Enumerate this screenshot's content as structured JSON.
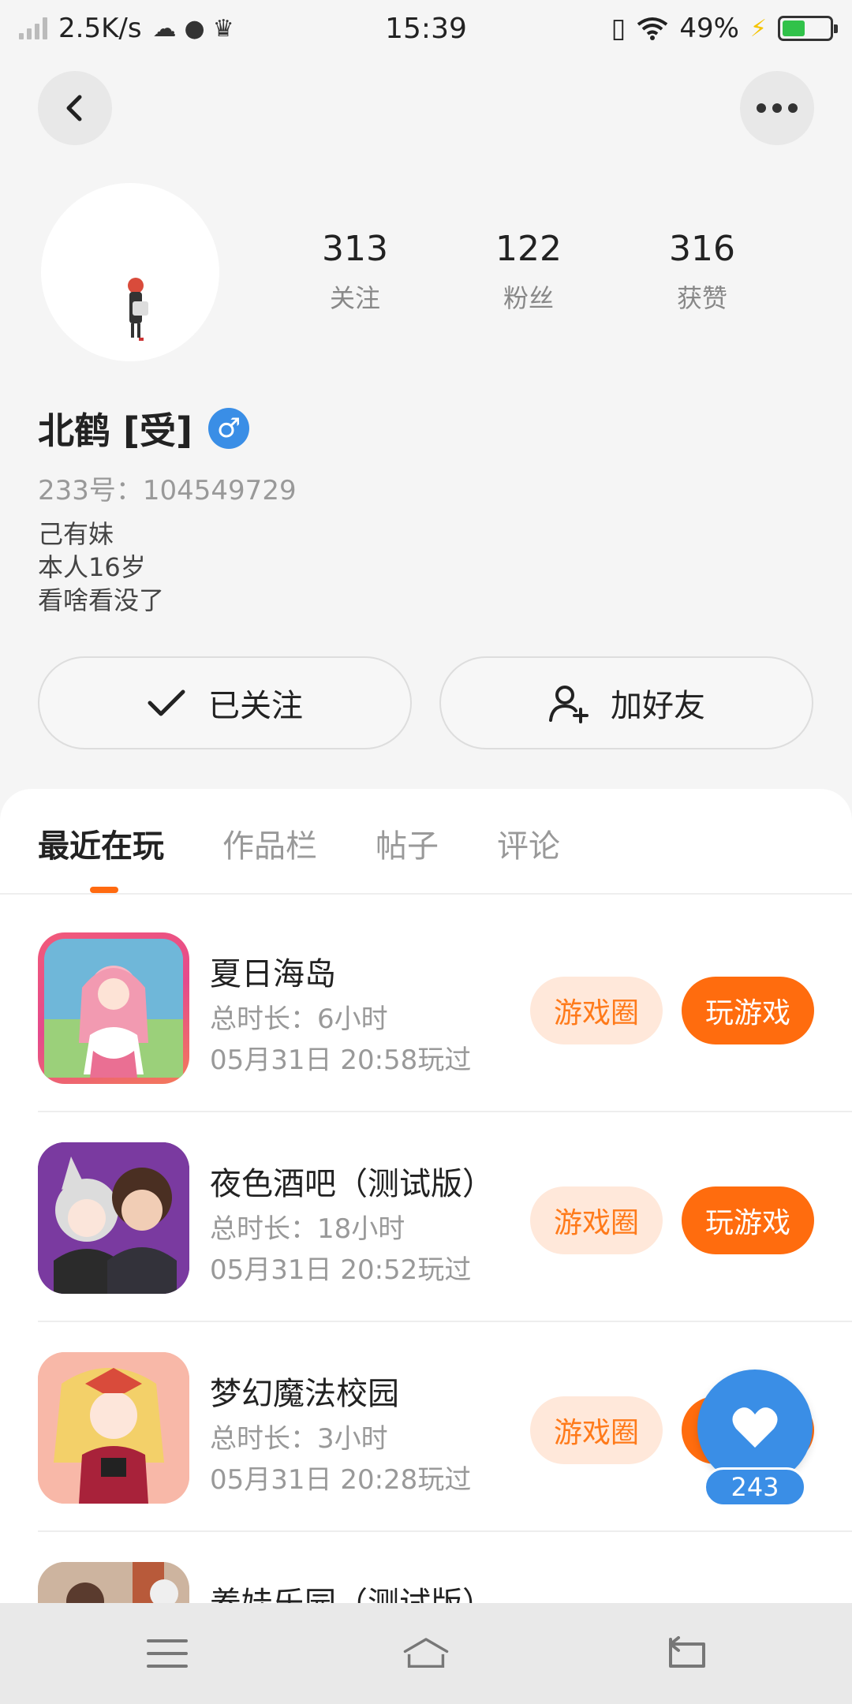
{
  "status_bar": {
    "speed": "2.5K/s",
    "time": "15:39",
    "battery_pct": "49%",
    "battery_level": 0.49
  },
  "profile": {
    "stats": [
      {
        "num": "313",
        "label": "关注"
      },
      {
        "num": "122",
        "label": "粉丝"
      },
      {
        "num": "316",
        "label": "获赞"
      }
    ],
    "name": "北鹤 [受]",
    "gender_symbol": "♂",
    "id_text": "233号：104549729",
    "bio": [
      "己有妹",
      "本人16岁",
      "看啥看没了"
    ],
    "follow_label": "已关注",
    "add_friend_label": "加好友"
  },
  "tabs": [
    "最近在玩",
    "作品栏",
    "帖子",
    "评论"
  ],
  "games": [
    {
      "title": "夏日海岛",
      "time": "总时长：6小时",
      "last": "05月31日 20:58玩过"
    },
    {
      "title": "夜色酒吧（测试版）",
      "time": "总时长：18小时",
      "last": "05月31日 20:52玩过"
    },
    {
      "title": "梦幻魔法校园",
      "time": "总时长：3小时",
      "last": "05月31日 20:28玩过"
    },
    {
      "title": "养娃乐园（测试版）",
      "time": "",
      "last": ""
    }
  ],
  "game_buttons": {
    "circle": "游戏圈",
    "play": "玩游戏"
  },
  "like_count": "243",
  "colors": {
    "accent": "#ff6c0e",
    "blue": "#3a8ee6"
  }
}
